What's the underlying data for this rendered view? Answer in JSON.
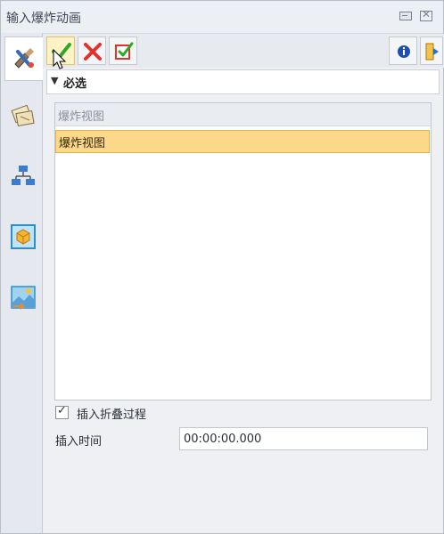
{
  "window": {
    "title": "输入爆炸动画"
  },
  "toolbar": {
    "ok": "确定",
    "cancel": "取消",
    "apply": "应用"
  },
  "section": {
    "label": "必选"
  },
  "list": {
    "header": "爆炸视图",
    "rows": [
      "爆炸视图"
    ]
  },
  "options": {
    "insert_fold_label": "插入折叠过程",
    "insert_fold_checked": true
  },
  "insert_time": {
    "label": "插入时间",
    "value": "00:00:00.000"
  },
  "icons": {
    "ok": "check-icon",
    "cancel": "x-icon",
    "apply": "apply-check-icon",
    "info": "info-icon",
    "help": "help-icon"
  },
  "colors": {
    "selection": "#fcd98a",
    "ok_green": "#2aa82a",
    "cancel_red": "#e0332d"
  }
}
